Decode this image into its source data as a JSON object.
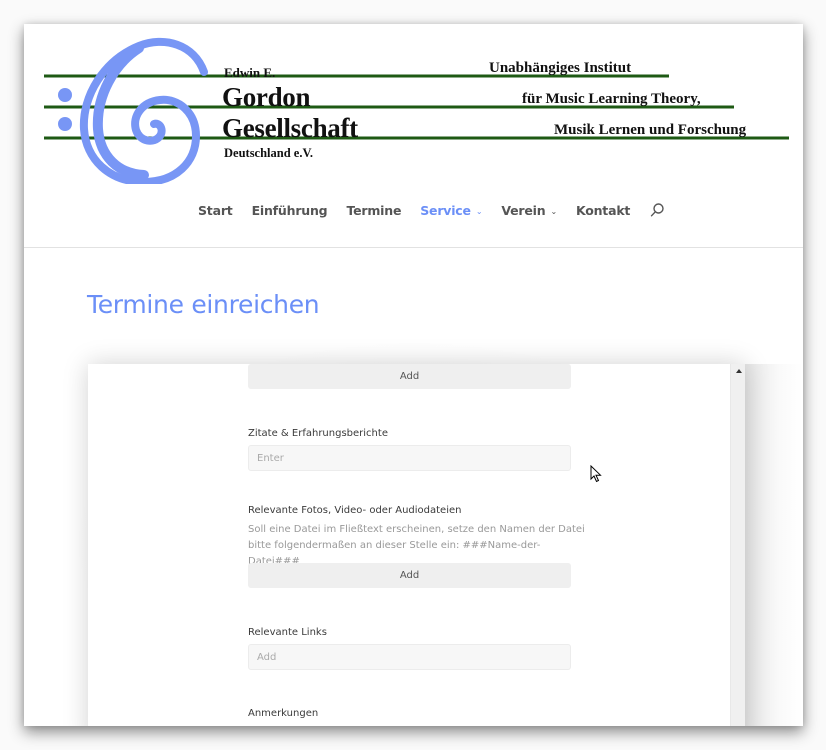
{
  "logo": {
    "line_edwin": "Edwin E.",
    "line_gordon": "Gordon",
    "line_gesellschaft": "Gesellschaft",
    "line_deutschland": "Deutschland e.V.",
    "tagline_1": "Unabhängiges Institut",
    "tagline_2": "für Music Learning Theory,",
    "tagline_3": "Musik Lernen und Forschung",
    "clef_color": "#7896f5",
    "staff_color": "#1e5a14"
  },
  "nav": {
    "items": [
      {
        "label": "Start",
        "active": false,
        "has_dropdown": false
      },
      {
        "label": "Einführung",
        "active": false,
        "has_dropdown": false
      },
      {
        "label": "Termine",
        "active": false,
        "has_dropdown": false
      },
      {
        "label": "Service",
        "active": true,
        "has_dropdown": true
      },
      {
        "label": "Verein",
        "active": false,
        "has_dropdown": true
      },
      {
        "label": "Kontakt",
        "active": false,
        "has_dropdown": false
      }
    ],
    "chevron": "⌄",
    "accent_color": "#6b8ff7"
  },
  "page": {
    "title": "Termine einreichen"
  },
  "form": {
    "top_add_button": "Add",
    "quotes": {
      "label": "Zitate & Erfahrungsberichte",
      "placeholder": "Enter"
    },
    "media": {
      "label": "Relevante Fotos, Video- oder Audiodateien",
      "help_line_1": "Soll eine Datei im Fließtext erscheinen, setze den Namen der Datei",
      "help_line_2": "bitte folgendermaßen an dieser Stelle ein: ###Name-der-Datei###",
      "add_button": "Add"
    },
    "links": {
      "label": "Relevante Links",
      "placeholder": "Add"
    },
    "notes": {
      "label": "Anmerkungen"
    }
  }
}
